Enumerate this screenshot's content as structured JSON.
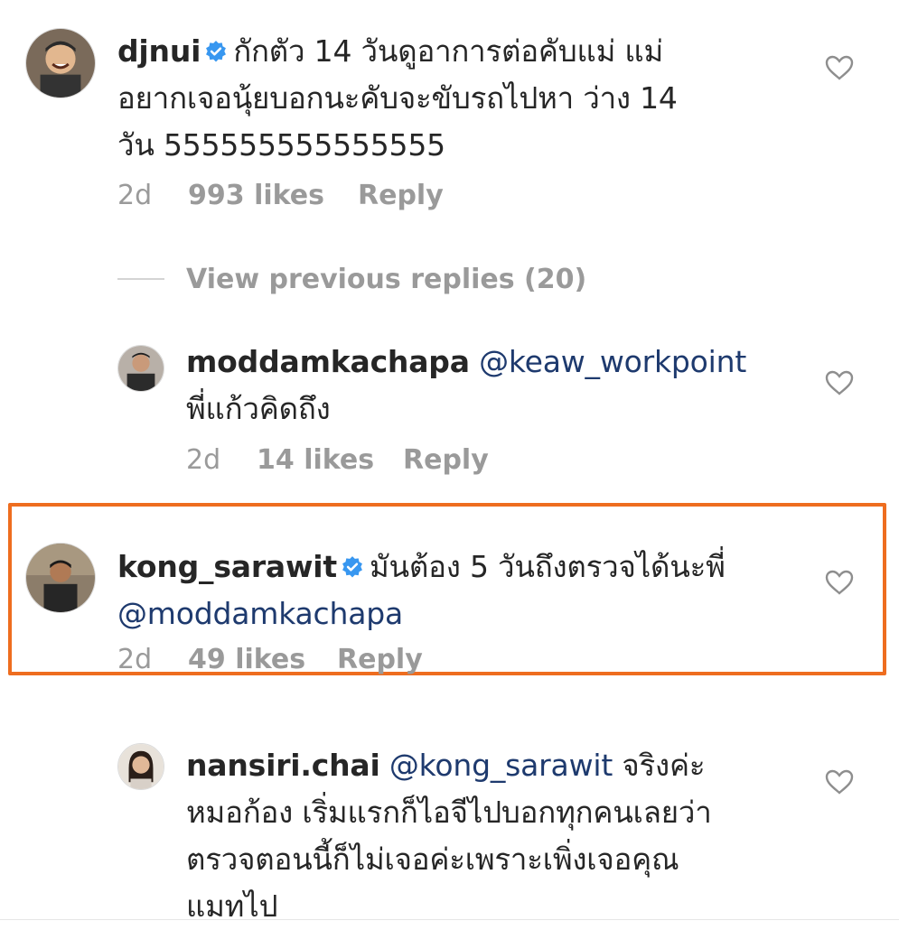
{
  "comments": [
    {
      "username": "djnui",
      "verified": true,
      "text": "กักตัว 14 วันดูอาการต่อคับแม่  แม่อยากเจอนุ้ยบอกนะคับจะขับรถไปหา ว่าง 14 วัน 555555555555555",
      "line1": "กักตัว 14 วันดูอาการต่อคับแม่  แม่",
      "line2": "อยากเจอนุ้ยบอกนะคับจะขับรถไปหา ว่าง 14",
      "line3": "วัน 555555555555555",
      "time": "2d",
      "likes": "993 likes",
      "reply": "Reply"
    },
    {
      "username": "moddamkachapa",
      "verified": false,
      "mention": "@keaw_workpoint",
      "text": "พี่แก้วคิดถึง",
      "time": "2d",
      "likes": "14 likes",
      "reply": "Reply"
    },
    {
      "username": "kong_sarawit",
      "verified": true,
      "text": "มันต้อง 5 วันถึงตรวจได้นะพี่",
      "mention": "@moddamkachapa",
      "time": "2d",
      "likes": "49 likes",
      "reply": "Reply",
      "highlighted": true
    },
    {
      "username": "nansiri.chai",
      "verified": false,
      "mention": "@kong_sarawit",
      "text_after_mention": "จริงค่ะ",
      "line2": "หมอก้อง เริ่มแรกก็ไอจีไปบอกทุกคนเลยว่า",
      "line3": "ตรวจตอนนี้ก็ไม่เจอค่ะเพราะเพิ่งเจอคุณ",
      "line4": "แมทไป"
    }
  ],
  "view_previous_replies": "View previous replies (20)",
  "colors": {
    "highlight_border": "#ee6d1f",
    "mention": "#1e3a6e",
    "verified_badge": "#3897f0",
    "meta_gray": "#9a9a9a"
  },
  "icons": [
    "heart-icon",
    "verified-badge-icon",
    "avatar"
  ]
}
